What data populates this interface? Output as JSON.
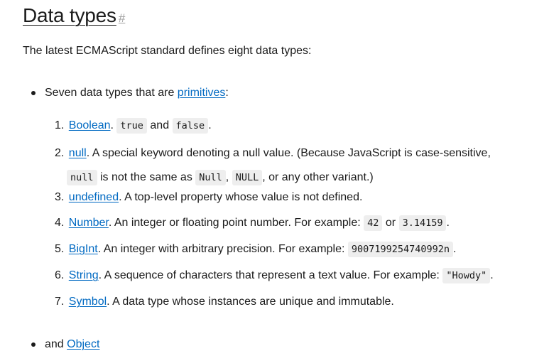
{
  "section": {
    "title": "Data types",
    "anchor": "#",
    "intro": "The latest ECMAScript standard defines eight data types:"
  },
  "bullets": {
    "first_prefix": "Seven data types that are ",
    "first_link": "primitives",
    "first_suffix": ":",
    "second_prefix": "and ",
    "second_link": "Object"
  },
  "types": [
    {
      "num": "1.",
      "link": "Boolean",
      "after_link": ".",
      "code1": "true",
      "mid": "and",
      "code2": "false",
      "end": "."
    },
    {
      "num": "2.",
      "link": "null",
      "text": ". A special keyword denoting a null value. (Because JavaScript is case-sensitive,",
      "code1": "null",
      "text2": "is not the same as",
      "code2": "Null",
      "sep": ",",
      "code3": "NULL",
      "text3": ", or any other variant.)"
    },
    {
      "num": "3.",
      "link": "undefined",
      "text": ". A top-level property whose value is not defined."
    },
    {
      "num": "4.",
      "link": "Number",
      "text": ". An integer or floating point number. For example:",
      "code1": "42",
      "mid": "or",
      "code2": "3.14159",
      "end": "."
    },
    {
      "num": "5.",
      "link": "BigInt",
      "text": ". An integer with arbitrary precision. For example:",
      "code1": "9007199254740992n",
      "end": "."
    },
    {
      "num": "6.",
      "link": "String",
      "text": ". A sequence of characters that represent a text value. For example:",
      "code1": "\"Howdy\"",
      "end": "."
    },
    {
      "num": "7.",
      "link": "Symbol",
      "text": ". A data type whose instances are unique and immutable."
    }
  ]
}
